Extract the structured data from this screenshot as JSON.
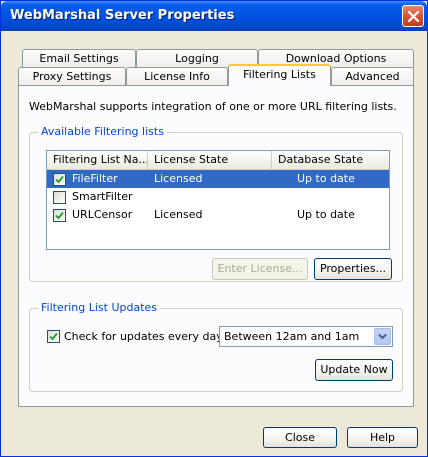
{
  "window": {
    "title": "WebMarshal Server Properties",
    "close_icon": "close-x-icon"
  },
  "tabs": {
    "row1": [
      "Email Settings",
      "Logging",
      "Download Options"
    ],
    "row2": [
      "Proxy Settings",
      "License Info",
      "Filtering Lists",
      "Advanced"
    ],
    "active": "Filtering Lists"
  },
  "panel": {
    "intro": "WebMarshal supports integration of one or more URL filtering lists.",
    "available_group_title": "Available Filtering lists",
    "columns": [
      "Filtering List Na...",
      "License State",
      "Database State"
    ],
    "rows": [
      {
        "name": "FileFilter",
        "license": "Licensed",
        "database": "Up to date",
        "checked": true,
        "selected": true
      },
      {
        "name": "SmartFilter",
        "license": "",
        "database": "",
        "checked": false,
        "selected": false
      },
      {
        "name": "URLCensor",
        "license": "Licensed",
        "database": "Up to date",
        "checked": true,
        "selected": false
      }
    ],
    "enter_license_button": "Enter License...",
    "properties_button": "Properties...",
    "updates_group_title": "Filtering List Updates",
    "check_updates_label": "Check for updates every day",
    "check_updates_checked": true,
    "update_time_selected": "Between 12am and 1am",
    "update_now_button": "Update Now"
  },
  "footer": {
    "close_button": "Close",
    "help_button": "Help"
  },
  "colors": {
    "title_bar": "#0054e3",
    "selection": "#316ac5",
    "group_title": "#0046d5",
    "active_tab_accent": "#ffc83c"
  }
}
